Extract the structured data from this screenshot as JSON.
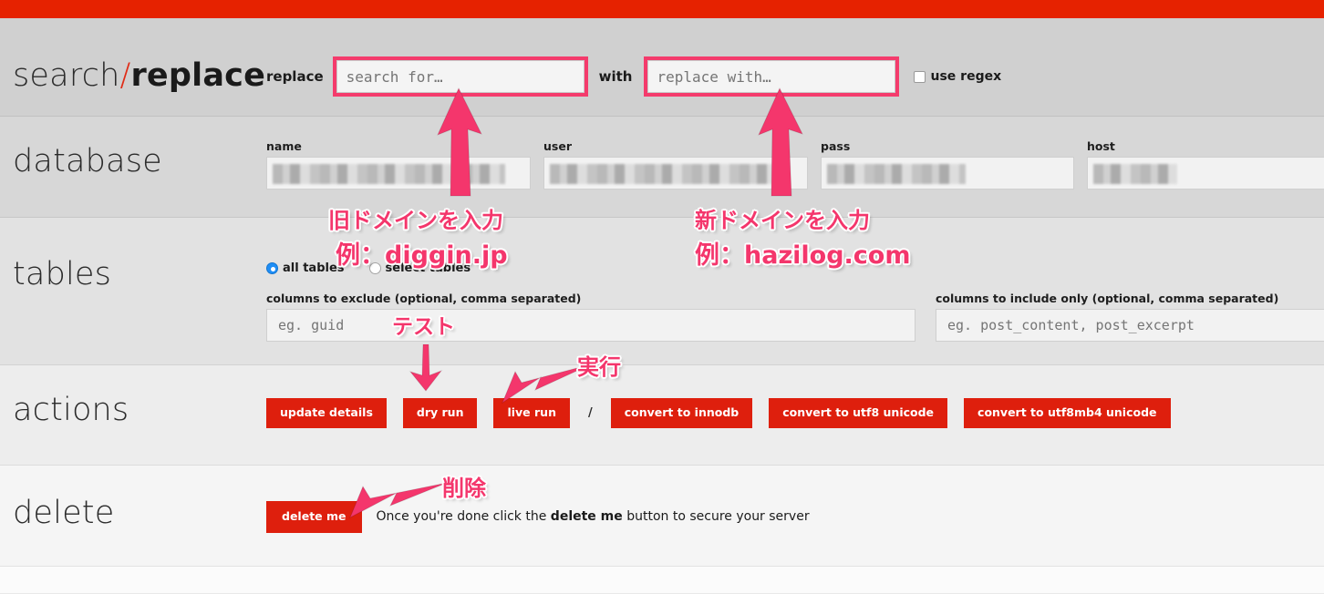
{
  "app": {
    "title_light": "search/",
    "title_part1": "search",
    "title_slash": "/",
    "title_bold": "replace"
  },
  "rows": {
    "search_label": "search/replace",
    "database_label": "database",
    "tables_label": "tables",
    "actions_label": "actions",
    "delete_label": "delete"
  },
  "search": {
    "replace_word": "replace",
    "with_word": "with",
    "search_for_placeholder": "search for…",
    "search_for_value": "",
    "replace_with_placeholder": "replace with…",
    "replace_with_value": "",
    "use_regex_label": "use regex",
    "use_regex_checked": false
  },
  "database": {
    "fields": [
      {
        "label": "name",
        "value": "",
        "redacted": true
      },
      {
        "label": "user",
        "value": "",
        "redacted": true
      },
      {
        "label": "pass",
        "value": "",
        "redacted": true
      },
      {
        "label": "host",
        "value": "",
        "redacted": true
      }
    ]
  },
  "tables": {
    "radio_all_label": "all tables",
    "radio_select_label": "select tables",
    "selected": "all tables",
    "exclude_label": "columns to exclude (optional, comma separated)",
    "exclude_placeholder": "eg. guid",
    "include_label": "columns to include only (optional, comma separated)",
    "include_placeholder": "eg. post_content, post_excerpt"
  },
  "actions": {
    "buttons": [
      "update details",
      "dry run",
      "live run",
      "convert to innodb",
      "convert to utf8 unicode",
      "convert to utf8mb4 unicode"
    ],
    "separator": "/"
  },
  "delete": {
    "button_label": "delete me",
    "note_prefix": "Once you're done click the ",
    "note_strong": "delete me",
    "note_suffix": " button to secure your server"
  },
  "annotations": [
    {
      "id": "old-domain",
      "line1": "旧ドメインを入力",
      "line2": "例：diggin.jp"
    },
    {
      "id": "new-domain",
      "line1": "新ドメインを入力",
      "line2": "例：hazilog.com"
    },
    {
      "id": "test",
      "text": "テスト"
    },
    {
      "id": "execute",
      "text": "実行"
    },
    {
      "id": "delete",
      "text": "削除"
    }
  ],
  "colors": {
    "topbar_red": "#e62200",
    "button_red": "#de1f0d",
    "annotation_pink": "#f4366c",
    "highlight_pink": "#f43b6c",
    "radio_blue": "#1f8ef6"
  }
}
